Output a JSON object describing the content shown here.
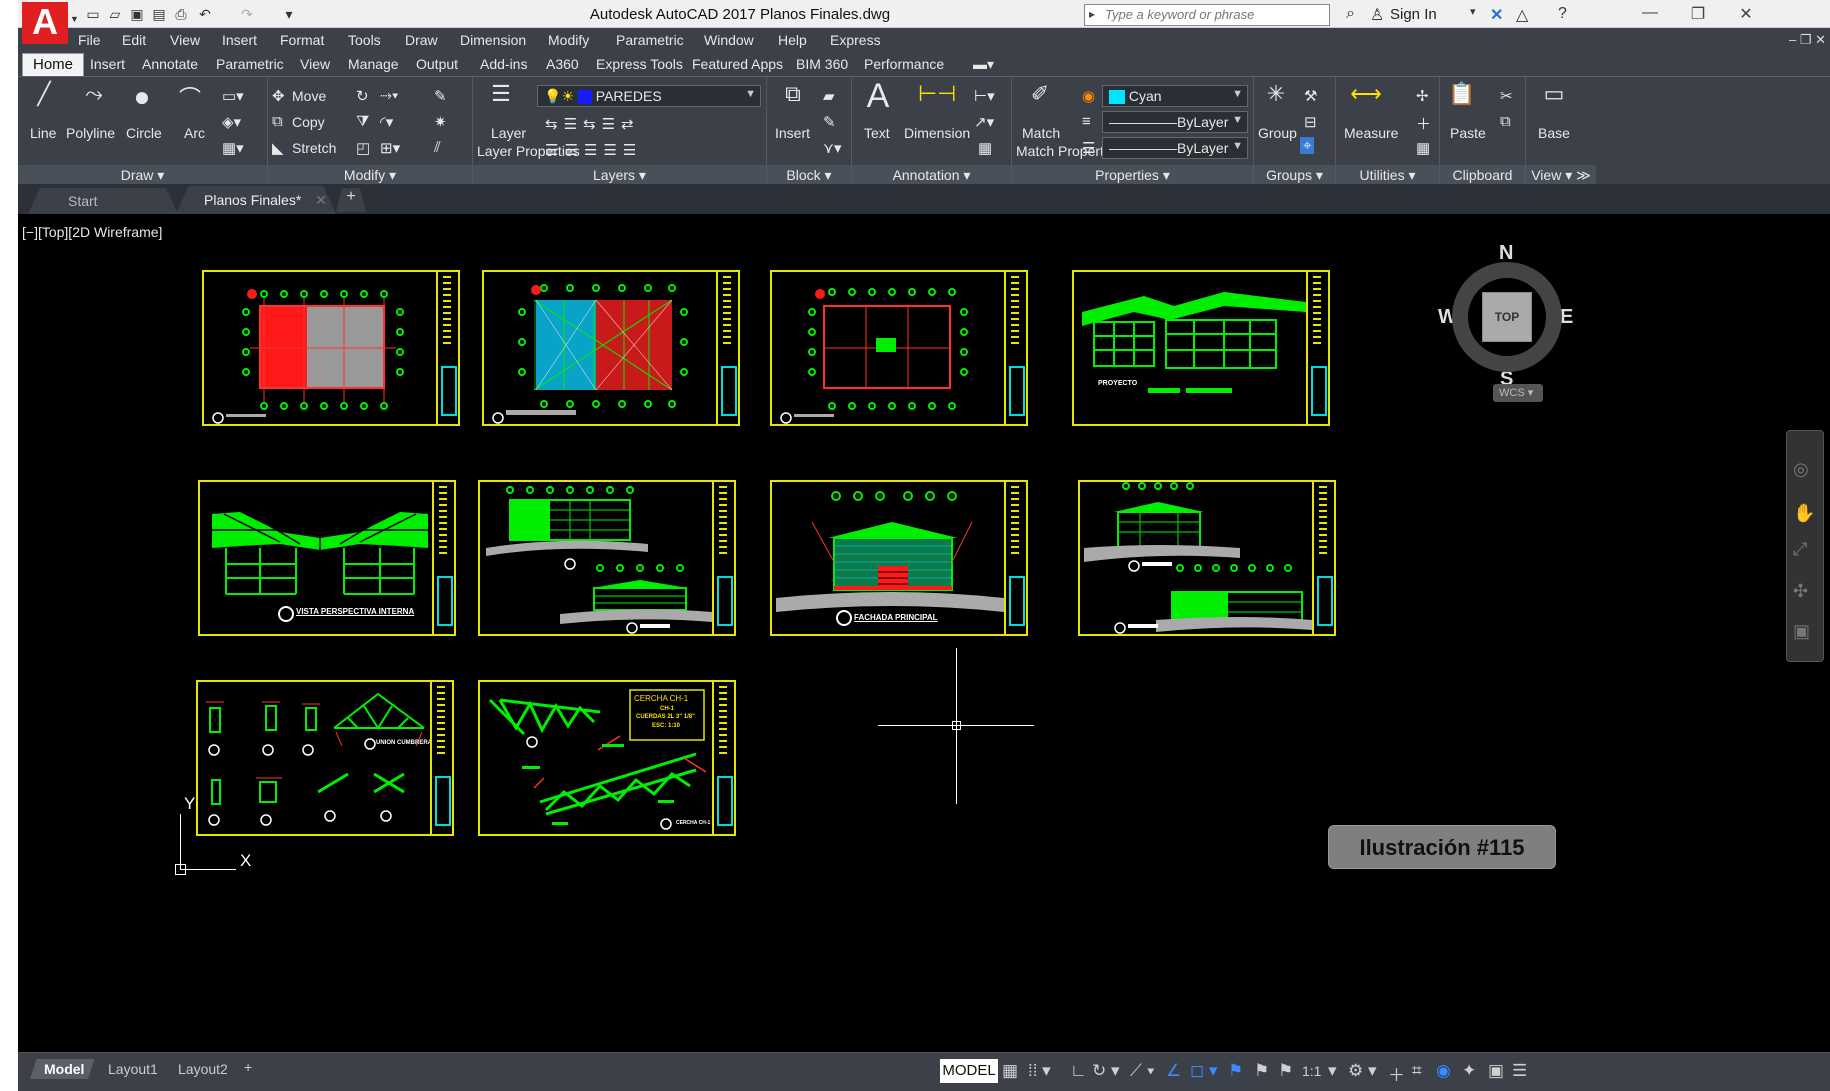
{
  "app": {
    "logo_letter": "A",
    "title": "Autodesk AutoCAD 2017    Planos Finales.dwg",
    "search_placeholder": "Type a keyword or phrase",
    "sign_in": "Sign In"
  },
  "menu": [
    "File",
    "Edit",
    "View",
    "Insert",
    "Format",
    "Tools",
    "Draw",
    "Dimension",
    "Modify",
    "Parametric",
    "Window",
    "Help",
    "Express"
  ],
  "ribbon_tabs": [
    "Home",
    "Insert",
    "Annotate",
    "Parametric",
    "View",
    "Manage",
    "Output",
    "Add-ins",
    "A360",
    "Express Tools",
    "Featured Apps",
    "BIM 360",
    "Performance"
  ],
  "ribbon": {
    "draw": {
      "label": "Draw",
      "tools": [
        "Line",
        "Polyline",
        "Circle",
        "Arc"
      ]
    },
    "modify": {
      "label": "Modify",
      "tools": [
        "Move",
        "Copy",
        "Stretch"
      ]
    },
    "layers": {
      "label": "Layers",
      "layer_properties": "Layer Properties",
      "current_layer": "PAREDES"
    },
    "block": {
      "label": "Block",
      "insert": "Insert"
    },
    "annotation": {
      "label": "Annotation",
      "text": "Text",
      "dimension": "Dimension"
    },
    "properties": {
      "label": "Properties",
      "match": "Match Properties",
      "color": "Cyan",
      "linetype": "ByLayer",
      "lineweight": "ByLayer"
    },
    "groups": {
      "label": "Groups",
      "group": "Group"
    },
    "utilities": {
      "label": "Utilities",
      "measure": "Measure"
    },
    "clipboard": {
      "label": "Clipboard",
      "paste": "Paste"
    },
    "view": {
      "label": "View",
      "base": "Base"
    }
  },
  "file_tabs": {
    "start": "Start",
    "active": "Planos Finales*"
  },
  "viewport": {
    "label": "[−][Top][2D Wireframe]",
    "viewcube": {
      "n": "N",
      "s": "S",
      "e": "E",
      "w": "W",
      "face": "TOP",
      "wcs": "WCS"
    },
    "ucs": {
      "x": "X",
      "y": "Y"
    },
    "badge": "Ilustración #115",
    "captions": {
      "proyecto": "PROYECTO",
      "vista_interna": "VISTA PERSPECTIVA INTERNA",
      "fachada": "FACHADA PRINCIPAL",
      "cercha_title": "CERCHA CH-1",
      "cercha_sub": "CH-1",
      "cercha_desc": "CUERDAS 2L 3\" 1/8\"",
      "cercha_scale": "ESC: 1:10",
      "union_cumbrera": "UNION CUMBRERA",
      "cercha_ch1": "CERCHA CH-1"
    }
  },
  "layout_tabs": [
    "Model",
    "Layout1",
    "Layout2"
  ],
  "status": {
    "model": "MODEL",
    "scale": "1:1"
  },
  "colors": {
    "sheet_border": "#e6e600",
    "green": "#00ee00",
    "red": "#ff1a1a",
    "cyan": "#00dddd",
    "ribbon_bg": "#3b4049"
  }
}
